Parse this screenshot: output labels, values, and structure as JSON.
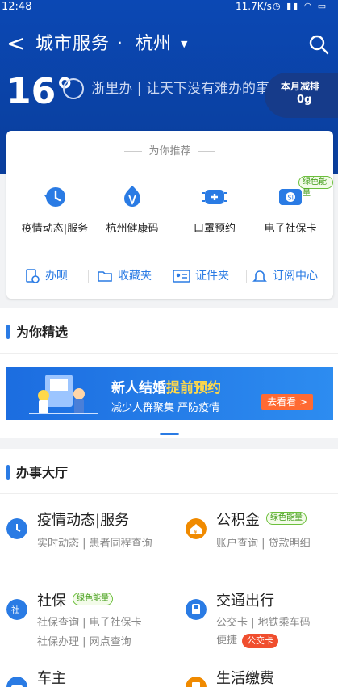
{
  "status_bar": {
    "time": "12:48",
    "speed": "11.7K/s"
  },
  "nav": {
    "title": "城市服务",
    "separator": "·",
    "city": "杭州"
  },
  "hero": {
    "temperature": "16°",
    "slogan": "浙里办 | 让天下没有难办的事",
    "carbon_label": "本月减排",
    "carbon_value": "0g"
  },
  "recommend": {
    "title": "为你推荐",
    "services": [
      {
        "label": "疫情动态|服务",
        "icon": "clock-return-icon"
      },
      {
        "label": "杭州健康码",
        "icon": "health-code-icon"
      },
      {
        "label": "口罩预约",
        "icon": "mask-icon"
      },
      {
        "label": "电子社保卡",
        "icon": "social-security-icon"
      }
    ],
    "green_tag": "绿色能量",
    "quick": [
      {
        "label": "办呗",
        "icon": "doc-clock-icon"
      },
      {
        "label": "收藏夹",
        "icon": "folder-icon"
      },
      {
        "label": "证件夹",
        "icon": "id-card-icon"
      },
      {
        "label": "订阅中心",
        "icon": "bell-icon"
      }
    ]
  },
  "picks": {
    "title": "为你精选",
    "banner": {
      "line1_a": "新人结婚",
      "line1_b": "提前预约",
      "line2": "减少人群聚集 严防疫情",
      "button": "去看看 >"
    }
  },
  "hall": {
    "title": "办事大厅",
    "items": [
      {
        "title": "疫情动态|服务",
        "sub1": "实时动态 | 患者同程查询",
        "icon": "clock-return-icon",
        "color": "#2a7be4"
      },
      {
        "title": "公积金",
        "tag": "绿色能量",
        "sub1": "账户查询 | 贷款明细",
        "icon": "house-yen-icon",
        "color": "#f08a00"
      },
      {
        "title": "社保",
        "tag": "绿色能量",
        "sub1": "社保查询 | 电子社保卡",
        "sub2": "社保办理 | 网点查询",
        "icon": "social-security-icon",
        "color": "#2a7be4"
      },
      {
        "title": "交通出行",
        "sub1": "公交卡 | 地铁乘车码",
        "sub2": "便捷",
        "red_tag": "公交卡",
        "icon": "bus-icon",
        "color": "#2a7be4"
      },
      {
        "title": "车主",
        "icon": "car-icon",
        "color": "#2a7be4"
      },
      {
        "title": "生活缴费",
        "icon": "bill-icon",
        "color": "#f08a00"
      }
    ]
  },
  "colors": {
    "brand_blue": "#0b48b4",
    "accent_blue": "#2a7be4",
    "green": "#3c9a12",
    "orange": "#f08a00",
    "red": "#f04e2e"
  }
}
